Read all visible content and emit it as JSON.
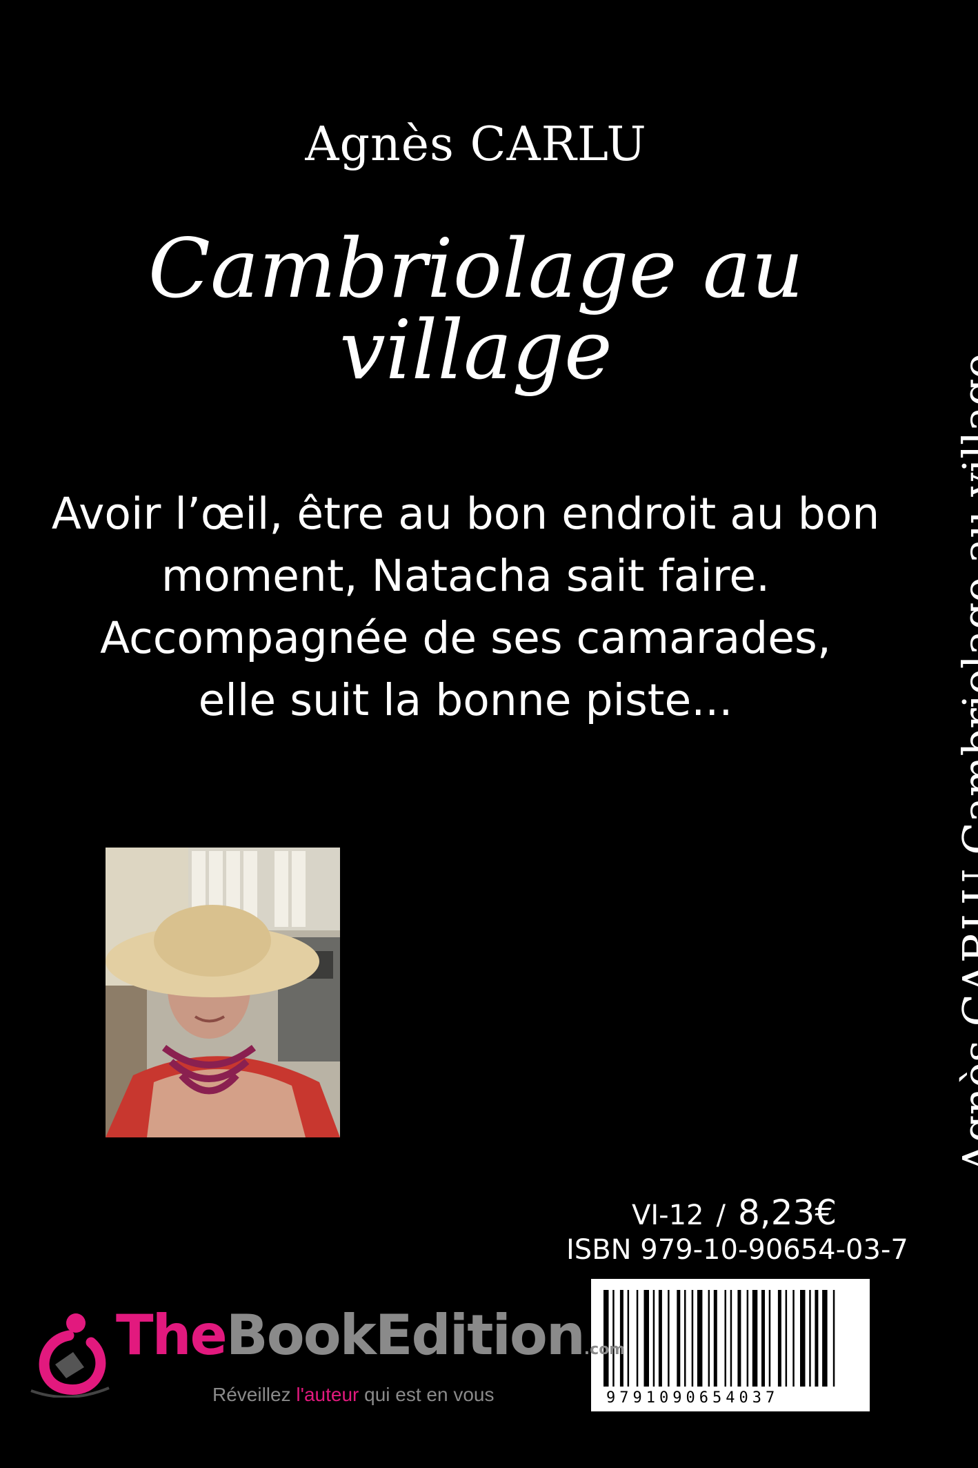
{
  "cover": {
    "author": "Agnès CARLU",
    "title": "Cambriolage au village",
    "blurb_lines": [
      "Avoir l’œil, être au bon endroit au bon",
      "moment, Natacha sait faire.",
      "Accompagnée de ses camarades,",
      "elle suit la bonne piste..."
    ],
    "spine_text": "Agnès CARLU    Cambriolage au village"
  },
  "product": {
    "age_range": "VI-12",
    "separator": "/",
    "price": "8,23€",
    "isbn": "ISBN 979-10-90654-03-7",
    "barcode_digits": "9791090654037"
  },
  "publisher": {
    "name_part1": "The",
    "name_part2": "BookEdition",
    "domain": ".com",
    "tagline_before": "Réveillez ",
    "tagline_highlight": "l'auteur",
    "tagline_after": " qui est en vous",
    "brand_color": "#e2197e",
    "gray_color": "#8a8a8a"
  }
}
